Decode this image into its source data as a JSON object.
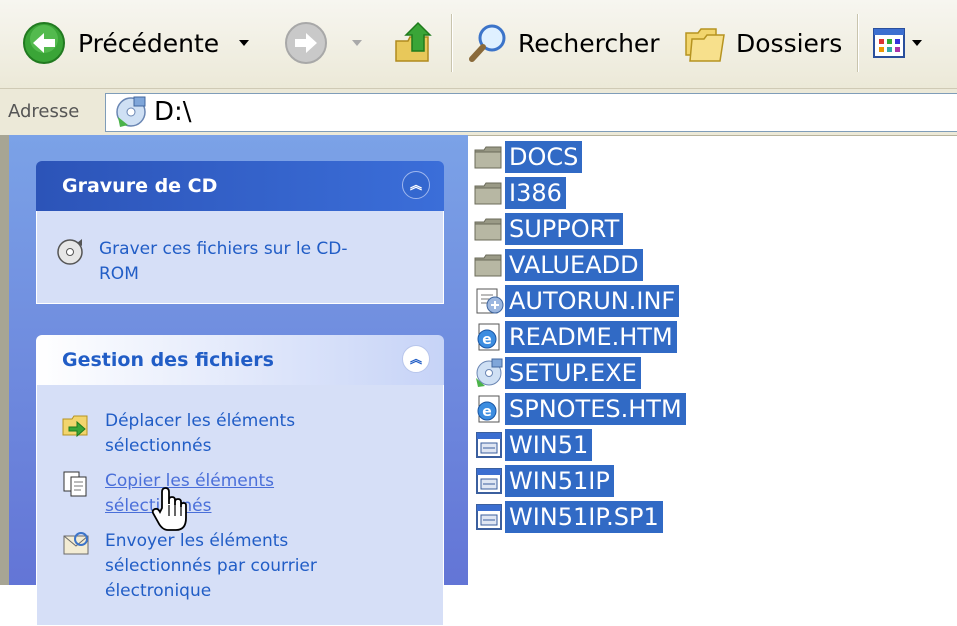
{
  "toolbar": {
    "back_label": "Précédente",
    "search_label": "Rechercher",
    "folders_label": "Dossiers"
  },
  "address": {
    "label": "Adresse",
    "value": "D:\\"
  },
  "taskpane": {
    "cd_panel": {
      "title": "Gravure de CD",
      "task": "Graver ces fichiers sur le CD-ROM"
    },
    "files_panel": {
      "title": "Gestion des fichiers",
      "tasks": [
        "Déplacer les éléments sélectionnés",
        "Copier les éléments sélectionnés",
        "Envoyer les éléments sélectionnés par courrier électronique"
      ]
    }
  },
  "files": [
    {
      "name": "DOCS",
      "icon": "folder-icon"
    },
    {
      "name": "I386",
      "icon": "folder-icon"
    },
    {
      "name": "SUPPORT",
      "icon": "folder-icon"
    },
    {
      "name": "VALUEADD",
      "icon": "folder-icon"
    },
    {
      "name": "AUTORUN.INF",
      "icon": "setup-info-icon"
    },
    {
      "name": "README.HTM",
      "icon": "html-document-icon"
    },
    {
      "name": "SETUP.EXE",
      "icon": "setup-exe-icon"
    },
    {
      "name": "SPNOTES.HTM",
      "icon": "html-document-icon"
    },
    {
      "name": "WIN51",
      "icon": "system-file-icon"
    },
    {
      "name": "WIN51IP",
      "icon": "system-file-icon"
    },
    {
      "name": "WIN51IP.SP1",
      "icon": "system-file-icon"
    }
  ],
  "colors": {
    "selection": "#316ac5",
    "taskpane": "#7ba2e7",
    "link": "#215dc6"
  }
}
